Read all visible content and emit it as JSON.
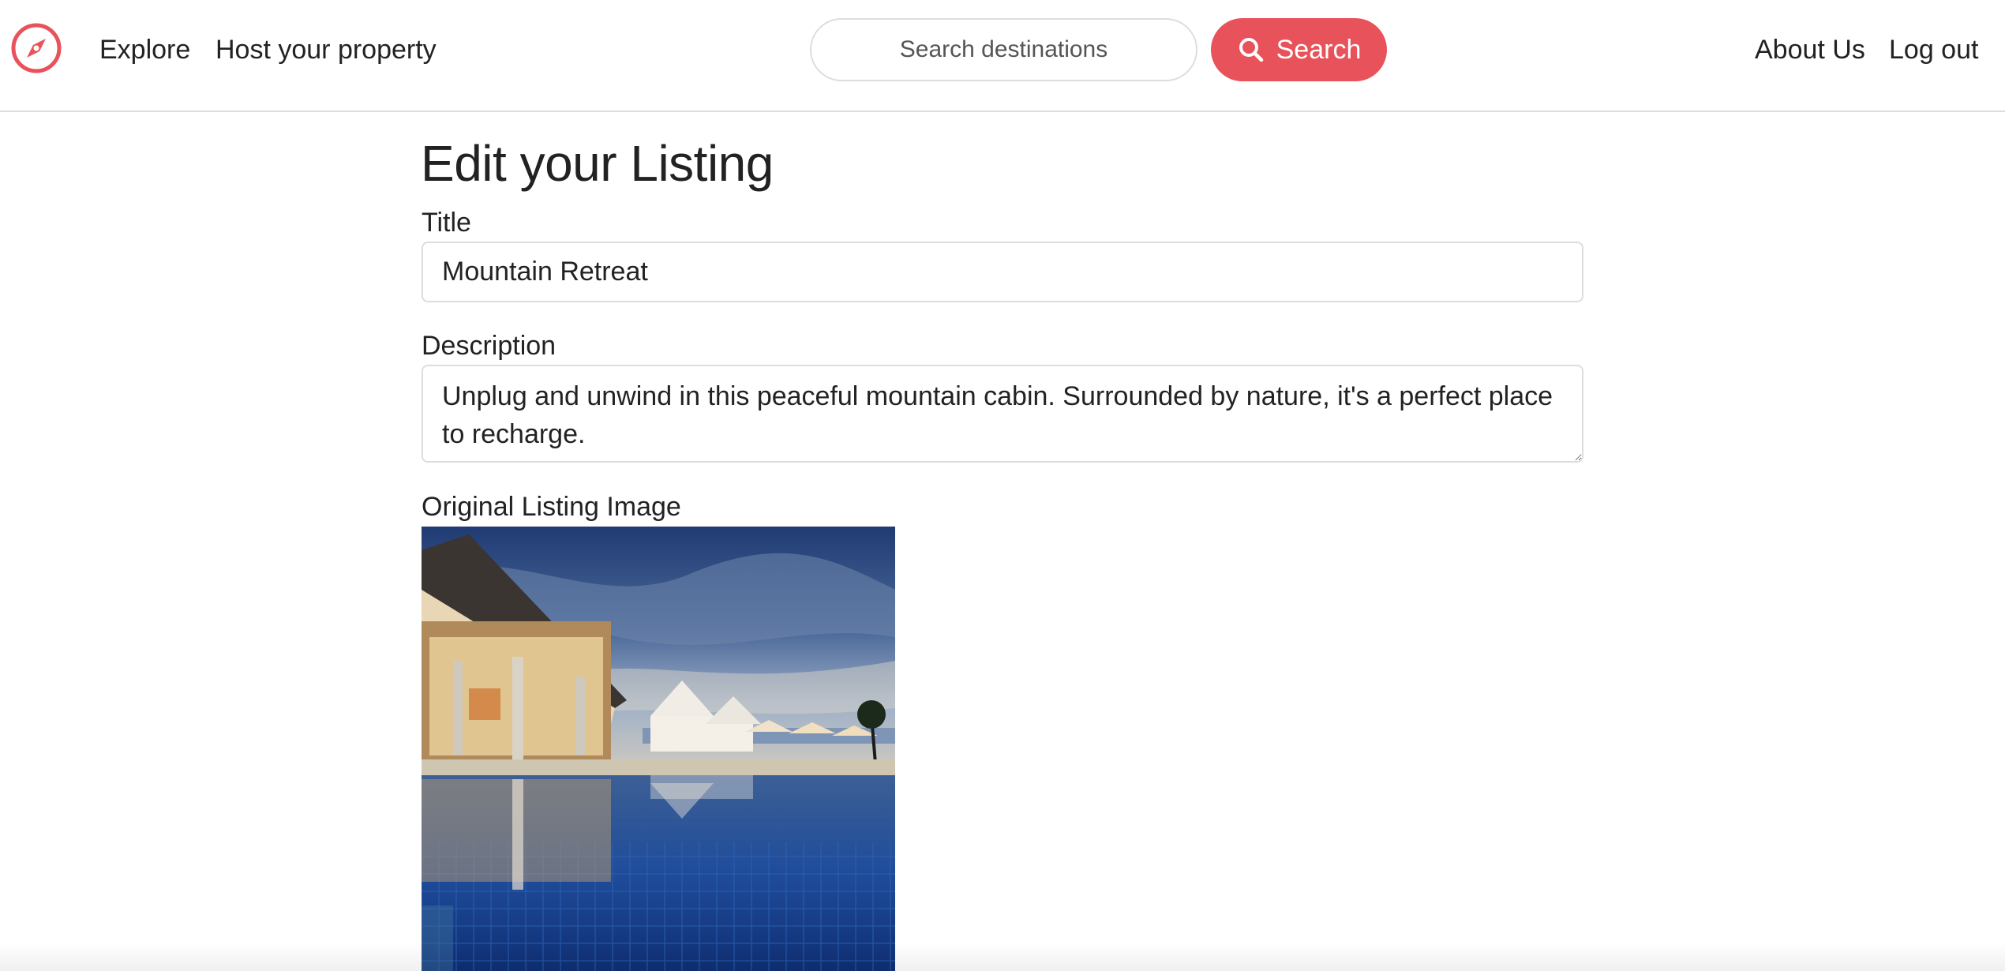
{
  "header": {
    "logo_icon": "compass-icon",
    "nav_left": [
      {
        "label": "Explore"
      },
      {
        "label": "Host your property"
      }
    ],
    "search": {
      "placeholder": "Search destinations",
      "value": "",
      "button_label": "Search",
      "button_icon": "search-icon"
    },
    "nav_right": [
      {
        "label": "About Us"
      },
      {
        "label": "Log out"
      }
    ]
  },
  "form": {
    "page_title": "Edit your Listing",
    "title_label": "Title",
    "title_value": "Mountain Retreat",
    "description_label": "Description",
    "description_value": "Unplug and unwind in this peaceful mountain cabin. Surrounded by nature, it's a perfect place to recharge.",
    "image_label": "Original Listing Image"
  },
  "colors": {
    "accent": "#e8525a",
    "border": "#dddddd",
    "text": "#222222"
  }
}
